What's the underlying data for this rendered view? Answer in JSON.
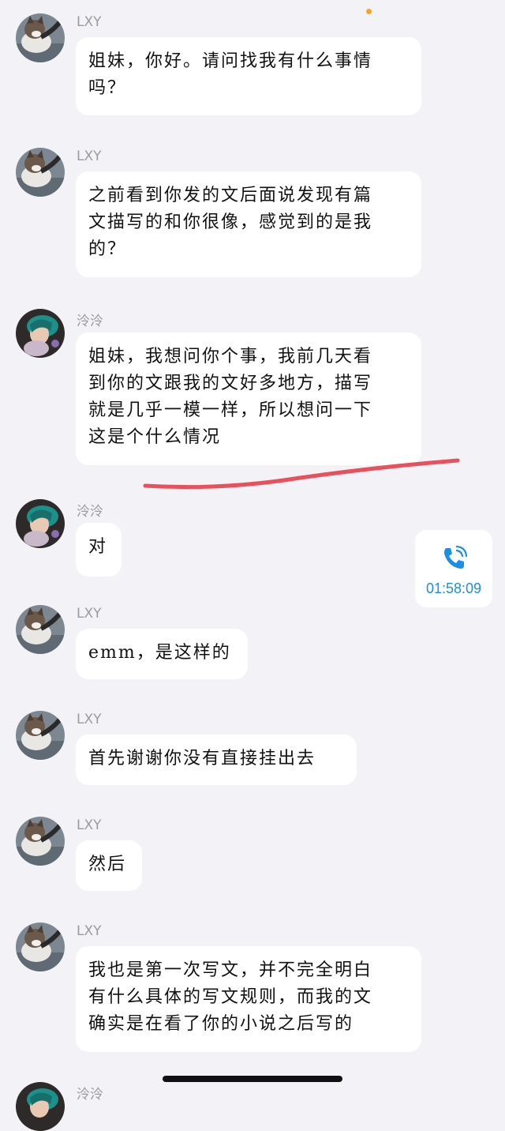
{
  "messages": [
    {
      "sender": "LXY",
      "text": "姐妹，你好。请问找我有什么事情\n吗？"
    },
    {
      "sender": "LXY",
      "text": "之前看到你发的文后面说发现有篇\n文描写的和你很像，感觉到的是我\n的？"
    },
    {
      "sender": "泠泠",
      "text": "姐妹，我想问你个事，我前几天看\n到你的文跟我的文好多地方，描写\n就是几乎一模一样，所以想问一下\n这是个什么情况"
    },
    {
      "sender": "泠泠",
      "text": "对"
    },
    {
      "sender": "LXY",
      "text": "emm，是这样的"
    },
    {
      "sender": "LXY",
      "text": "首先谢谢你没有直接挂出去"
    },
    {
      "sender": "LXY",
      "text": "然后"
    },
    {
      "sender": "LXY",
      "text": "我也是第一次写文，并不完全明白\n有什么具体的写文规则，而我的文\n确实是在看了你的小说之后写的"
    },
    {
      "sender": "泠泠",
      "text": ""
    }
  ],
  "call": {
    "icon": "phone-call-icon",
    "duration": "01:58:09",
    "color": "#1a8fe3"
  },
  "annotation_color": "#e8505b",
  "status_dot_color": "#f5a623"
}
